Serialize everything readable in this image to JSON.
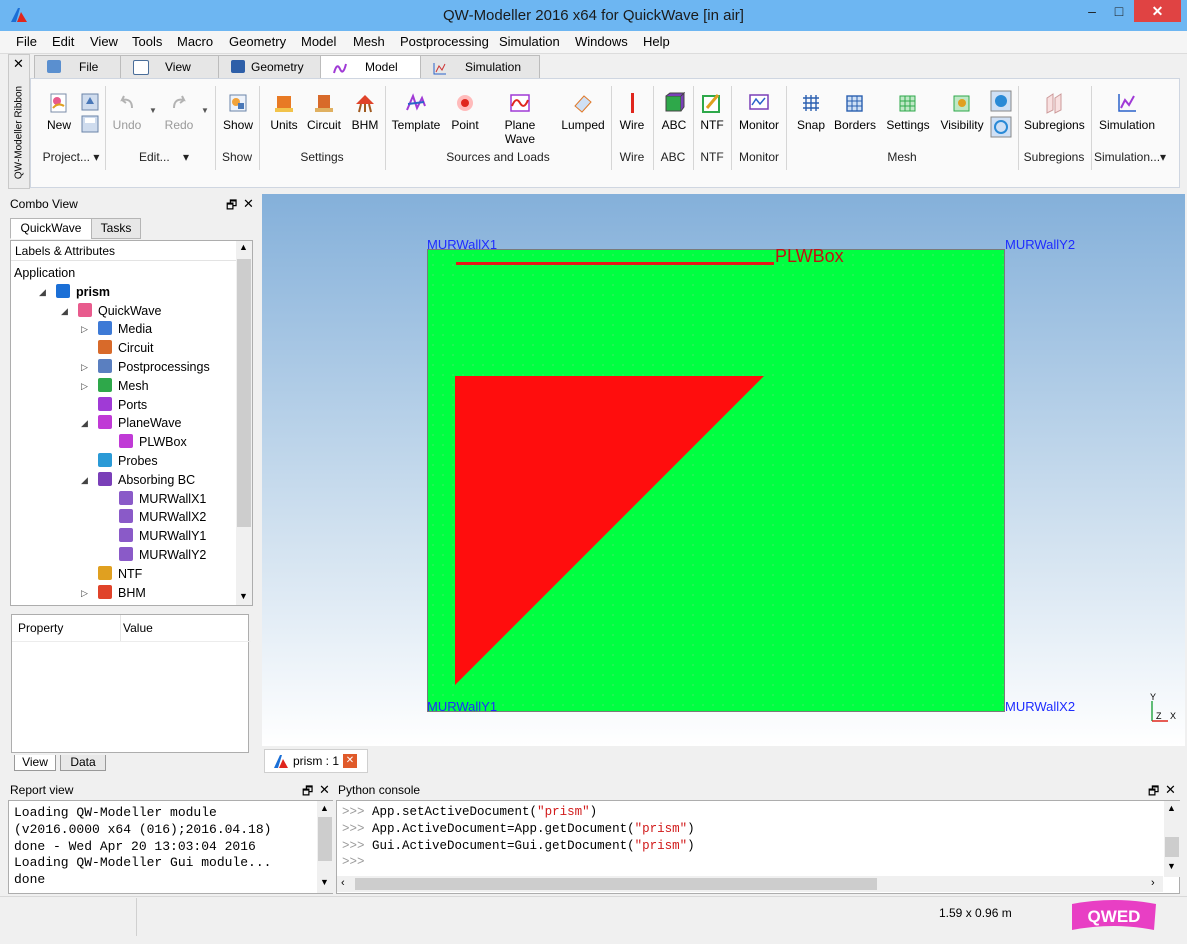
{
  "window": {
    "title": "QW-Modeller 2016 x64 for QuickWave [in air]",
    "minimize": "–",
    "maximize": "□",
    "close": "✕"
  },
  "menu": [
    "File",
    "Edit",
    "View",
    "Tools",
    "Macro",
    "Geometry",
    "Model",
    "Mesh",
    "Postprocessing",
    "Simulation",
    "Windows",
    "Help"
  ],
  "ribbon": {
    "side_close": "✕",
    "side_label": "QW-Modeller Ribbon",
    "tabs": [
      {
        "label": "File",
        "active": false
      },
      {
        "label": "View",
        "active": false
      },
      {
        "label": "Geometry",
        "active": false
      },
      {
        "label": "Model",
        "active": true
      },
      {
        "label": "Simulation",
        "active": false
      }
    ],
    "buttons": {
      "new": "New",
      "undo": "Undo",
      "redo": "Redo",
      "show": "Show",
      "units": "Units",
      "circuit": "Circuit",
      "bhm": "BHM",
      "template": "Template",
      "point": "Point",
      "plane_wave": "Plane Wave",
      "lumped": "Lumped",
      "wire": "Wire",
      "abc": "ABC",
      "ntf": "NTF",
      "monitor": "Monitor",
      "snap": "Snap",
      "borders": "Borders",
      "settings": "Settings",
      "visibility": "Visibility",
      "subregions": "Subregions",
      "simulation": "Simulation"
    },
    "groups": {
      "project": "Project...",
      "edit": "Edit...",
      "show": "Show",
      "settings": "Settings",
      "sources": "Sources and Loads",
      "wire": "Wire",
      "abc": "ABC",
      "ntf": "NTF",
      "monitor": "Monitor",
      "mesh": "Mesh",
      "subregions": "Subregions",
      "simulation": "Simulation..."
    }
  },
  "combo_view": {
    "title": "Combo View",
    "float_icon": "🗗",
    "close_icon": "✕",
    "tabs": [
      "QuickWave",
      "Tasks"
    ],
    "tree_header": "Labels & Attributes",
    "tree": [
      {
        "label": "Application",
        "level": 0,
        "expander": "",
        "icon": ""
      },
      {
        "label": "prism",
        "level": 1,
        "expander": "◢",
        "icon": "document-icon",
        "bold": true
      },
      {
        "label": "QuickWave",
        "level": 2,
        "expander": "◢",
        "icon": "quickwave-icon"
      },
      {
        "label": "Media",
        "level": 3,
        "expander": "▷",
        "icon": "media-icon"
      },
      {
        "label": "Circuit",
        "level": 3,
        "expander": "",
        "icon": "circuit-icon"
      },
      {
        "label": "Postprocessings",
        "level": 3,
        "expander": "▷",
        "icon": "postprocessing-icon"
      },
      {
        "label": "Mesh",
        "level": 3,
        "expander": "▷",
        "icon": "mesh-icon"
      },
      {
        "label": "Ports",
        "level": 3,
        "expander": "",
        "icon": "ports-icon"
      },
      {
        "label": "PlaneWave",
        "level": 3,
        "expander": "◢",
        "icon": "planewave-icon"
      },
      {
        "label": "PLWBox",
        "level": 4,
        "expander": "",
        "icon": "planewave-icon"
      },
      {
        "label": "Probes",
        "level": 3,
        "expander": "",
        "icon": "probes-icon"
      },
      {
        "label": "Absorbing BC",
        "level": 3,
        "expander": "◢",
        "icon": "abc-icon"
      },
      {
        "label": "MURWallX1",
        "level": 4,
        "expander": "",
        "icon": "wall-icon"
      },
      {
        "label": "MURWallX2",
        "level": 4,
        "expander": "",
        "icon": "wall-icon"
      },
      {
        "label": "MURWallY1",
        "level": 4,
        "expander": "",
        "icon": "wall-icon"
      },
      {
        "label": "MURWallY2",
        "level": 4,
        "expander": "",
        "icon": "wall-icon"
      },
      {
        "label": "NTF",
        "level": 3,
        "expander": "",
        "icon": "ntf-icon"
      },
      {
        "label": "BHM",
        "level": 3,
        "expander": "▷",
        "icon": "bhm-icon"
      }
    ],
    "property_headers": [
      "Property",
      "Value"
    ],
    "bottom_tabs": [
      "View",
      "Data"
    ]
  },
  "viewport": {
    "labels": {
      "x1": "MURWallX1",
      "y2": "MURWallY2",
      "y1": "MURWallY1",
      "x2": "MURWallX2",
      "plwbox": "PLWBox"
    },
    "axis_y": "Y",
    "axis_z": "Z",
    "axis_x": "X",
    "doc_tab": "prism : 1",
    "colors": {
      "domain": "#00ff41",
      "prism": "#ff0d0d",
      "plane_wave": "#e31818",
      "wall_label": "#1e2cff"
    }
  },
  "report_view": {
    "title": "Report view",
    "lines": [
      "Loading QW-Modeller module",
      "(v2016.0000 x64 (016);2016.04.18)",
      "done - Wed Apr 20 13:03:04 2016",
      "Loading QW-Modeller Gui module...",
      "done"
    ]
  },
  "python_console": {
    "title": "Python console",
    "prompt": ">>>",
    "lines": [
      {
        "code": "App.setActiveDocument(",
        "arg": "\"prism\"",
        "end": ")"
      },
      {
        "code": "App.ActiveDocument=App.getDocument(",
        "arg": "\"prism\"",
        "end": ")"
      },
      {
        "code": "Gui.ActiveDocument=Gui.getDocument(",
        "arg": "\"prism\"",
        "end": ")"
      }
    ]
  },
  "status": {
    "dimensions": "1.59 x 0.96 m",
    "logo_text": "QWED"
  }
}
